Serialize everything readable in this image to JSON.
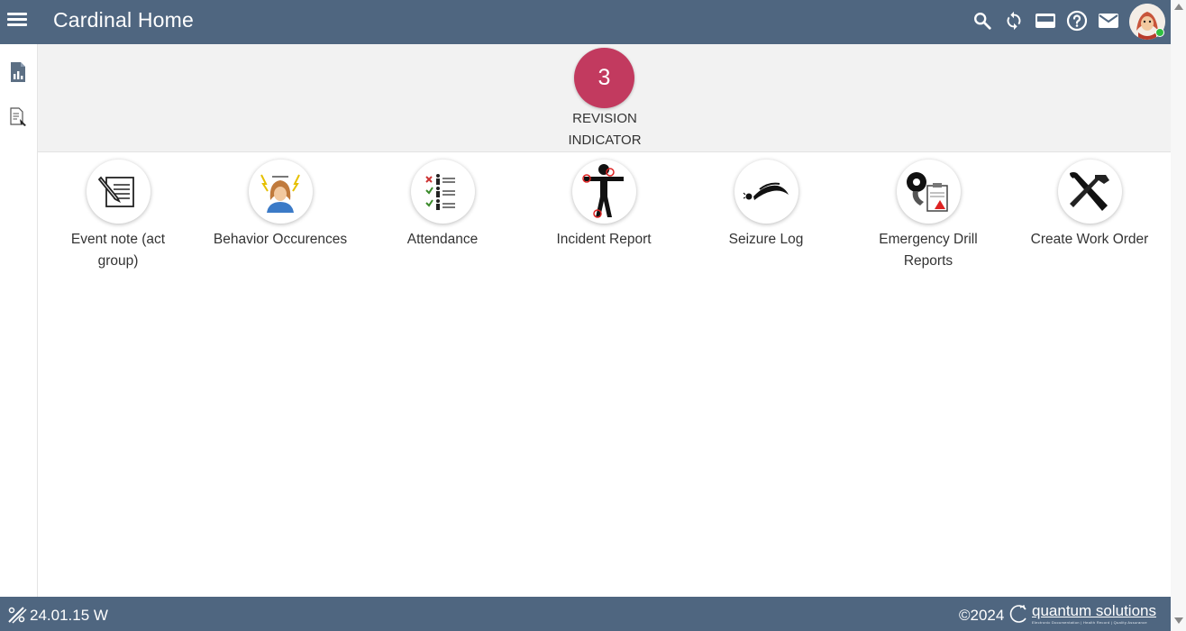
{
  "header": {
    "title": "Cardinal Home",
    "icons": [
      "search-icon",
      "sync-icon",
      "credit-card-icon",
      "help-icon",
      "mail-icon"
    ]
  },
  "sidebar": {
    "icons": [
      "report-chart-icon",
      "document-search-icon"
    ]
  },
  "indicator": {
    "count": "3",
    "label_line1": "REVISION",
    "label_line2": "INDICATOR"
  },
  "tiles": [
    {
      "label": "Event note (act group)",
      "icon": "event-note-icon"
    },
    {
      "label": "Behavior Occurences",
      "icon": "behavior-icon"
    },
    {
      "label": "Attendance",
      "icon": "attendance-icon"
    },
    {
      "label": "Incident Report",
      "icon": "incident-report-icon"
    },
    {
      "label": "Seizure Log",
      "icon": "seizure-log-icon"
    },
    {
      "label": "Emergency Drill Reports",
      "icon": "emergency-drill-icon"
    },
    {
      "label": "Create Work Order",
      "icon": "work-order-icon"
    }
  ],
  "footer": {
    "version": "24.01.15 W",
    "copyright": "©2024",
    "brand": "quantum solutions",
    "tagline": "Electronic Documentation | Health Record | Quality Assurance"
  },
  "colors": {
    "bar": "#4f6680",
    "indicator": "#c23a5f",
    "online": "#2fbf40"
  }
}
